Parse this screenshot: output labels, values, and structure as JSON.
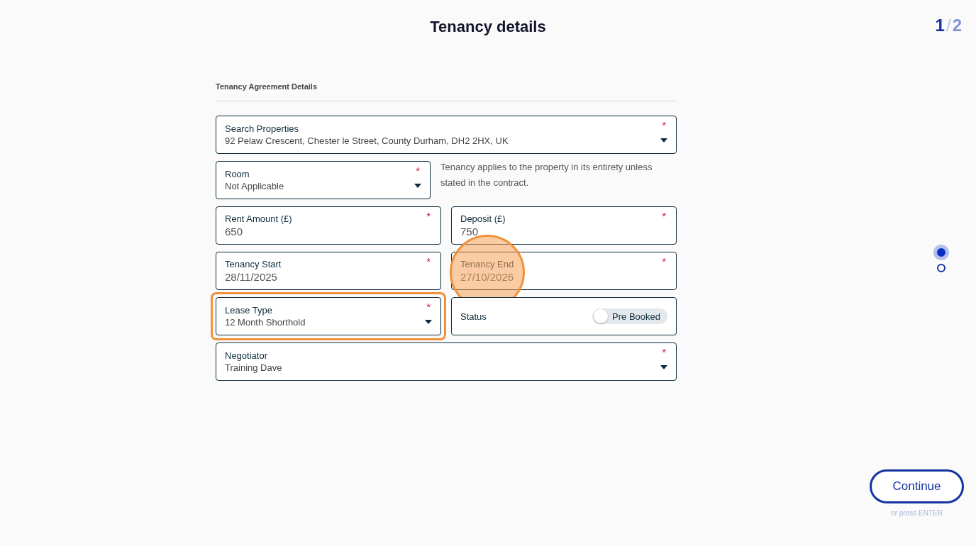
{
  "title": "Tenancy details",
  "pager": {
    "current": "1",
    "separator": "/",
    "total": "2"
  },
  "section_title": "Tenancy Agreement Details",
  "rows": [
    [
      {
        "kind": "select",
        "label": "Search Properties",
        "value": "92 Pelaw Crescent, Chester le Street, County Durham, DH2 2HX, UK",
        "required_mark": "*",
        "highlighted": false,
        "clicked": false
      }
    ],
    [
      {
        "kind": "select",
        "label": "Room",
        "value": "Not Applicable",
        "required_mark": "*",
        "highlighted": false,
        "clicked": false
      },
      {
        "kind": "note",
        "text": "Tenancy applies to the property in its entirety unless stated in the contract."
      }
    ],
    [
      {
        "kind": "text",
        "label": "Rent Amount (£)",
        "value": "650",
        "required_mark": "*",
        "highlighted": false,
        "clicked": false
      },
      {
        "kind": "text",
        "label": "Deposit (£)",
        "value": "750",
        "required_mark": "*",
        "highlighted": false,
        "clicked": false
      }
    ],
    [
      {
        "kind": "text",
        "label": "Tenancy Start",
        "value": "28/11/2025",
        "required_mark": "*",
        "highlighted": false,
        "clicked": false
      },
      {
        "kind": "text",
        "label": "Tenancy End",
        "value": "27/10/2026",
        "required_mark": "*",
        "highlighted": false,
        "clicked": true
      }
    ],
    [
      {
        "kind": "select",
        "label": "Lease Type",
        "value": "12 Month Shorthold",
        "required_mark": "*",
        "highlighted": true,
        "clicked": false
      },
      {
        "kind": "toggle",
        "label": "Status",
        "value": "Pre Booked",
        "on": false,
        "highlighted": false,
        "clicked": false
      }
    ],
    [
      {
        "kind": "select",
        "label": "Negotiator",
        "value": "Training Dave",
        "required_mark": "*",
        "highlighted": false,
        "clicked": false
      }
    ]
  ],
  "steps": [
    {
      "selected": true
    },
    {
      "selected": false
    }
  ],
  "continue_button": "Continue",
  "continue_hint": "or press ENTER"
}
